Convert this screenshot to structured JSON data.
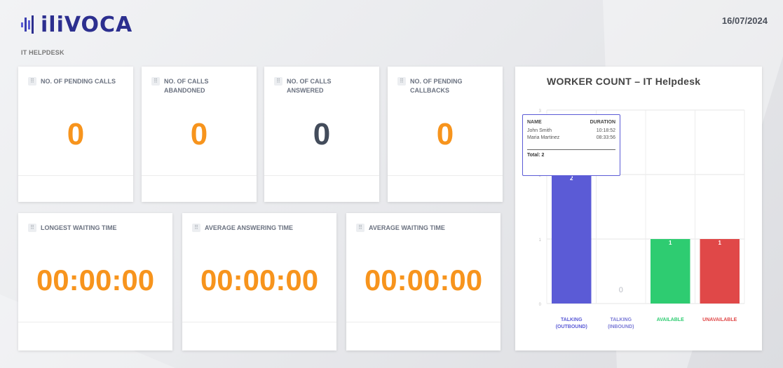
{
  "app": {
    "logo_text": "iliVOCA",
    "date": "16/07/2024"
  },
  "section": {
    "label": "IT HELPDESK"
  },
  "cards_top": [
    {
      "title": "NO. OF PENDING CALLS",
      "value": "0"
    },
    {
      "title": "NO. OF CALLS ABANDONED",
      "value": "0"
    },
    {
      "title": "NO. OF CALLS ANSWERED",
      "value": "0"
    },
    {
      "title": "NO. OF PENDING CALLBACKS",
      "value": "0"
    }
  ],
  "cards_bottom": [
    {
      "title": "LONGEST WAITING TIME",
      "value": "00:00:00"
    },
    {
      "title": "AVERAGE ANSWERING TIME",
      "value": "00:00:00"
    },
    {
      "title": "AVERAGE WAITING TIME",
      "value": "00:00:00"
    }
  ],
  "colors": {
    "accent": "#f7941d",
    "slate": "#434c5b",
    "talking_outbound": "#5b5bd6",
    "talking_inbound": "#7b7bd6",
    "available": "#2ecc71",
    "unavailable": "#e04848"
  },
  "chart_data": {
    "type": "bar",
    "title": "WORKER COUNT – IT Helpdesk",
    "categories": [
      "TALKING (OUTBOUND)",
      "TALKING (INBOUND)",
      "AVAILABLE",
      "UNAVAILABLE"
    ],
    "category_lines": [
      [
        "TALKING",
        "(OUTBOUND)"
      ],
      [
        "TALKING",
        "(INBOUND)"
      ],
      [
        "AVAILABLE"
      ],
      [
        "UNAVAILABLE"
      ]
    ],
    "values": [
      2,
      0,
      1,
      1
    ],
    "data_labels": [
      "2",
      "0",
      "1",
      "1"
    ],
    "ylim": [
      0,
      3
    ],
    "yticks": [
      "0",
      "1",
      "2",
      "3"
    ],
    "grid": true
  },
  "tooltip": {
    "col_name": "NAME",
    "col_duration": "DURATION",
    "rows": [
      {
        "name": "John Smith",
        "duration": "10:18:52"
      },
      {
        "name": "Maria Martinez",
        "duration": "08:33:56"
      }
    ],
    "total": "Total: 2"
  }
}
